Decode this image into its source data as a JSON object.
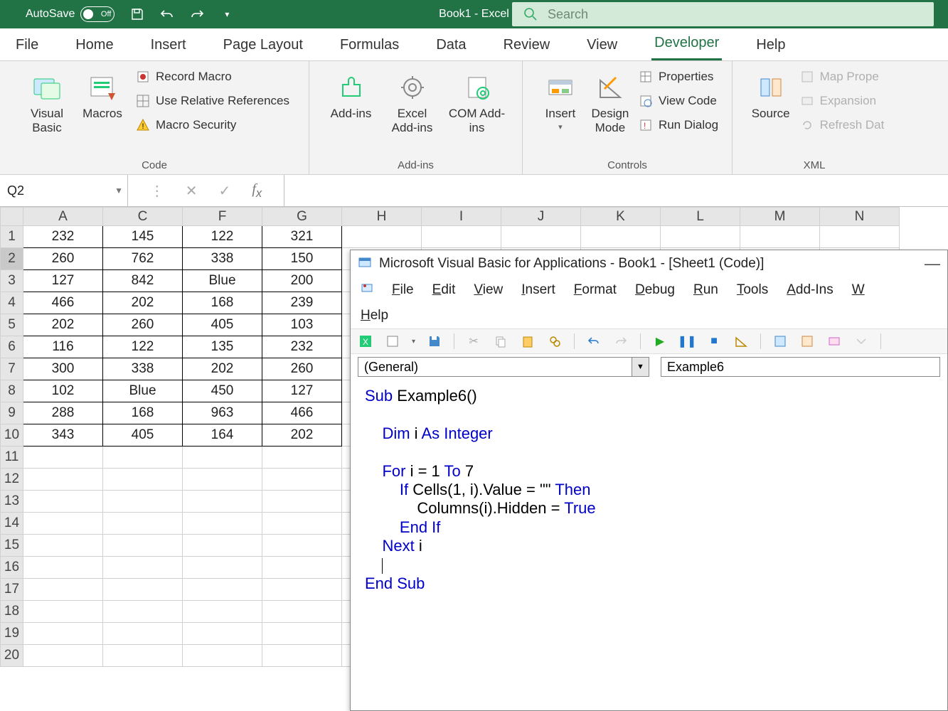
{
  "titlebar": {
    "autosave_label": "AutoSave",
    "autosave_state": "Off",
    "doc_title": "Book1 - Excel",
    "search_placeholder": "Search"
  },
  "ribbon_tabs": [
    "File",
    "Home",
    "Insert",
    "Page Layout",
    "Formulas",
    "Data",
    "Review",
    "View",
    "Developer",
    "Help"
  ],
  "active_tab": "Developer",
  "ribbon": {
    "code": {
      "visual_basic": "Visual Basic",
      "macros": "Macros",
      "record_macro": "Record Macro",
      "use_rel": "Use Relative References",
      "macro_security": "Macro Security",
      "group_label": "Code"
    },
    "addins": {
      "addins1": "Add-ins",
      "addins2": "Excel Add-ins",
      "addins3": "COM Add-ins",
      "group_label": "Add-ins"
    },
    "controls": {
      "insert": "Insert",
      "design": "Design Mode",
      "properties": "Properties",
      "view_code": "View Code",
      "run_dialog": "Run Dialog",
      "group_label": "Controls"
    },
    "xml": {
      "source": "Source",
      "map_props": "Map Prope",
      "expansion": "Expansion",
      "refresh": "Refresh Dat",
      "group_label": "XML"
    }
  },
  "namebox": "Q2",
  "formula_value": "",
  "columns": [
    "A",
    "C",
    "F",
    "G",
    "H",
    "I",
    "J",
    "K",
    "L",
    "M",
    "N"
  ],
  "rows_shown": 20,
  "data_rows": [
    [
      "232",
      "145",
      "122",
      "321"
    ],
    [
      "260",
      "762",
      "338",
      "150"
    ],
    [
      "127",
      "842",
      "Blue",
      "200"
    ],
    [
      "466",
      "202",
      "168",
      "239"
    ],
    [
      "202",
      "260",
      "405",
      "103"
    ],
    [
      "116",
      "122",
      "135",
      "232"
    ],
    [
      "300",
      "338",
      "202",
      "260"
    ],
    [
      "102",
      "Blue",
      "450",
      "127"
    ],
    [
      "288",
      "168",
      "963",
      "466"
    ],
    [
      "343",
      "405",
      "164",
      "202"
    ]
  ],
  "vba": {
    "title": "Microsoft Visual Basic for Applications - Book1 - [Sheet1 (Code)]",
    "menus": [
      "File",
      "Edit",
      "View",
      "Insert",
      "Format",
      "Debug",
      "Run",
      "Tools",
      "Add-Ins",
      "W"
    ],
    "help": "Help",
    "combo_left": "(General)",
    "combo_right": "Example6",
    "code_lines": [
      {
        "indent": 0,
        "tokens": [
          {
            "t": "Sub ",
            "k": true
          },
          {
            "t": "Example6()"
          }
        ]
      },
      {
        "indent": 0,
        "tokens": []
      },
      {
        "indent": 1,
        "tokens": [
          {
            "t": "Dim ",
            "k": true
          },
          {
            "t": "i "
          },
          {
            "t": "As Integer",
            "k": true
          }
        ]
      },
      {
        "indent": 0,
        "tokens": []
      },
      {
        "indent": 1,
        "tokens": [
          {
            "t": "For ",
            "k": true
          },
          {
            "t": "i = 1 "
          },
          {
            "t": "To ",
            "k": true
          },
          {
            "t": "7"
          }
        ]
      },
      {
        "indent": 2,
        "tokens": [
          {
            "t": "If ",
            "k": true
          },
          {
            "t": "Cells(1, i).Value = \"\" "
          },
          {
            "t": "Then",
            "k": true
          }
        ]
      },
      {
        "indent": 3,
        "tokens": [
          {
            "t": "Columns(i).Hidden = "
          },
          {
            "t": "True",
            "k": true
          }
        ]
      },
      {
        "indent": 2,
        "tokens": [
          {
            "t": "End If",
            "k": true
          }
        ]
      },
      {
        "indent": 1,
        "tokens": [
          {
            "t": "Next ",
            "k": true
          },
          {
            "t": "i"
          }
        ]
      },
      {
        "indent": 1,
        "tokens": [],
        "caret": true
      },
      {
        "indent": 0,
        "tokens": [
          {
            "t": "End Sub",
            "k": true
          }
        ]
      }
    ]
  }
}
